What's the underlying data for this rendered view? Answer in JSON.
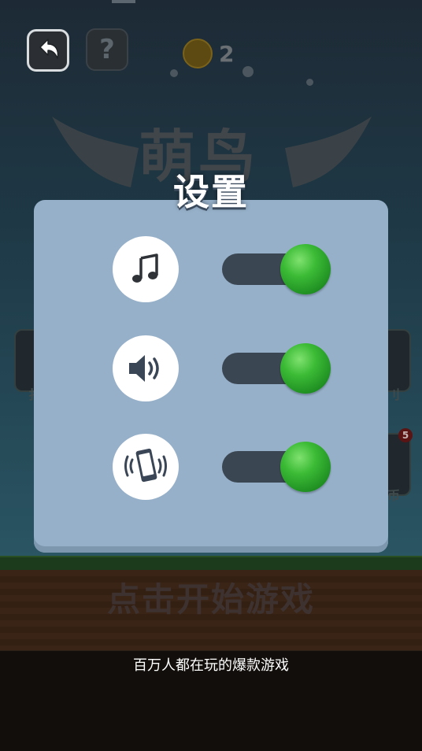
{
  "game": {
    "coin_count": "2",
    "logo_title": "萌鸟",
    "start_prompt": "点击开始游戏",
    "help_symbol": "?",
    "side_left_label": "扌",
    "side_right_label_1": "刂",
    "side_right_label_2": "币",
    "badge_count": "5"
  },
  "settings": {
    "title": "设置",
    "toggles": [
      {
        "name": "music",
        "icon": "music-note-icon",
        "enabled": true
      },
      {
        "name": "sound",
        "icon": "speaker-icon",
        "enabled": true
      },
      {
        "name": "vibration",
        "icon": "phone-vibrate-icon",
        "enabled": true
      }
    ],
    "accent_color": "#2fae30",
    "panel_color": "#96b0c9"
  },
  "banner": {
    "slogan": "百万人都在玩的爆款游戏"
  }
}
